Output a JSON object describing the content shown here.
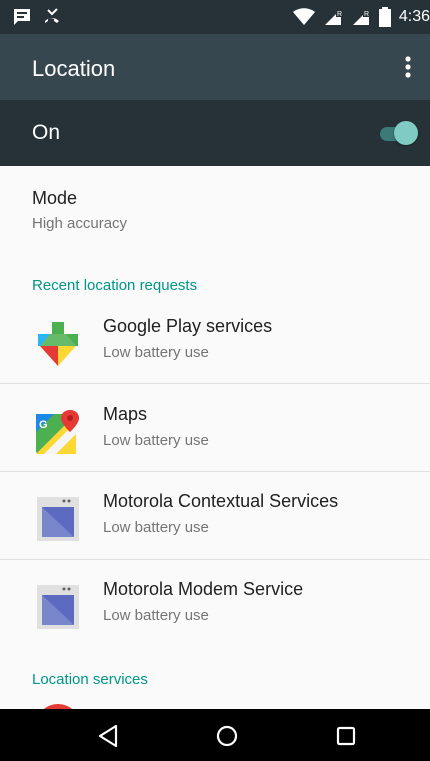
{
  "status_bar": {
    "time": "4:36",
    "icons": [
      "message-icon",
      "missed-call-icon",
      "wifi-icon",
      "signal-roaming-icon",
      "signal-icon",
      "battery-icon"
    ]
  },
  "app_bar": {
    "title": "Location",
    "more_icon": "more-vert-icon"
  },
  "master_switch": {
    "label": "On",
    "state": "on",
    "accent": "#4db6ac"
  },
  "mode": {
    "title": "Mode",
    "summary": "High accuracy"
  },
  "recent_header": "Recent location requests",
  "recent_requests": [
    {
      "name": "Google Play services",
      "summary": "Low battery use",
      "icon": "google-play-services-icon"
    },
    {
      "name": "Maps",
      "summary": "Low battery use",
      "icon": "google-maps-icon"
    },
    {
      "name": "Motorola Contextual Services",
      "summary": "Low battery use",
      "icon": "motorola-app-icon"
    },
    {
      "name": "Motorola Modem Service",
      "summary": "Low battery use",
      "icon": "motorola-app-icon"
    }
  ],
  "services_header": "Location services",
  "nav_bar": {
    "buttons": [
      "back-icon",
      "home-icon",
      "recents-icon"
    ]
  },
  "colors": {
    "app_bar": "#37474f",
    "status_bar": "#263238",
    "section_header": "#009688"
  }
}
